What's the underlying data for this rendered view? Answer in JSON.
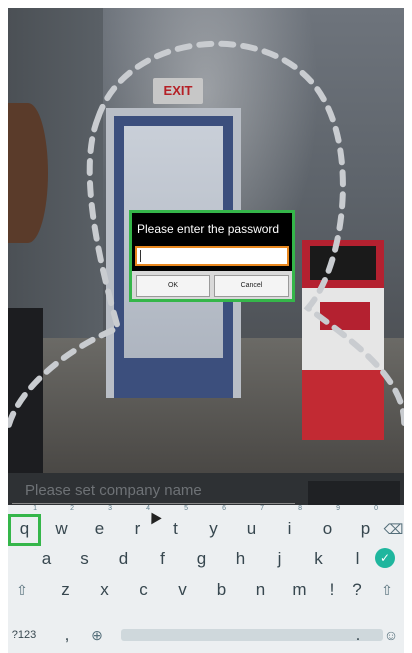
{
  "camera": {
    "exit_sign": "EXIT"
  },
  "dialog": {
    "title": "Please enter the password",
    "password_value": "",
    "ok_label": "OK",
    "cancel_label": "Cancel"
  },
  "company": {
    "placeholder": "Please set company name"
  },
  "keyboard": {
    "row1": [
      {
        "k": "q",
        "h": "1"
      },
      {
        "k": "w",
        "h": "2"
      },
      {
        "k": "e",
        "h": "3"
      },
      {
        "k": "r",
        "h": "4"
      },
      {
        "k": "t",
        "h": "5"
      },
      {
        "k": "y",
        "h": "6"
      },
      {
        "k": "u",
        "h": "7"
      },
      {
        "k": "i",
        "h": "8"
      },
      {
        "k": "o",
        "h": "9"
      },
      {
        "k": "p",
        "h": "0"
      }
    ],
    "row2": [
      "a",
      "s",
      "d",
      "f",
      "g",
      "h",
      "j",
      "k",
      "l"
    ],
    "row3": [
      "z",
      "x",
      "c",
      "v",
      "b",
      "n",
      "m",
      "!",
      "?"
    ],
    "symbols_label": "?123",
    "comma": ",",
    "period": "."
  },
  "colors": {
    "highlight": "#35b64a",
    "input_border": "#e8871e",
    "enter_key": "#1fb69e"
  }
}
